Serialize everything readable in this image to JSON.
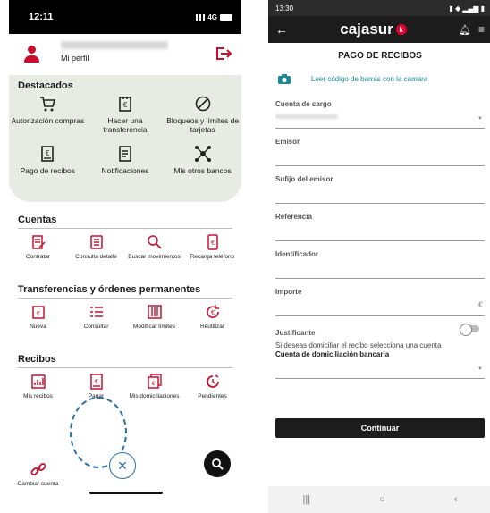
{
  "left": {
    "status": {
      "time": "12:11",
      "network": "4G"
    },
    "profile": {
      "link": "Mi perfil"
    },
    "destacados": {
      "title": "Destacados",
      "items": [
        {
          "label": "Autorización compras",
          "icon": "cart-icon"
        },
        {
          "label": "Hacer una transferencia",
          "icon": "transfer-euro-icon"
        },
        {
          "label": "Bloqueos y límites de tarjetas",
          "icon": "block-icon"
        },
        {
          "label": "Pago de recibos",
          "icon": "receipt-euro-icon"
        },
        {
          "label": "Notificaciones",
          "icon": "notification-doc-icon"
        },
        {
          "label": "Mis otros bancos",
          "icon": "network-icon"
        }
      ]
    },
    "cuentas": {
      "title": "Cuentas",
      "items": [
        {
          "label": "Contratar",
          "icon": "contract-icon"
        },
        {
          "label": "Consulta detalle",
          "icon": "list-doc-icon"
        },
        {
          "label": "Buscar movimientos",
          "icon": "search-icon"
        },
        {
          "label": "Recarga teléfono",
          "icon": "phone-euro-icon"
        }
      ]
    },
    "transferencias": {
      "title": "Transferencias y órdenes permanentes",
      "items": [
        {
          "label": "Nueva",
          "icon": "new-transfer-icon"
        },
        {
          "label": "Consultar",
          "icon": "list-icon"
        },
        {
          "label": "Modificar límites",
          "icon": "sliders-icon"
        },
        {
          "label": "Reutilizar",
          "icon": "reuse-euro-icon"
        }
      ]
    },
    "recibos": {
      "title": "Recibos",
      "items": [
        {
          "label": "Mis recibos",
          "icon": "receipts-chart-icon"
        },
        {
          "label": "Pagar",
          "icon": "pay-receipt-icon"
        },
        {
          "label": "Mis domiciliaciones",
          "icon": "direct-debit-icon"
        },
        {
          "label": "Pendientes",
          "icon": "pending-clock-icon"
        }
      ],
      "extra": {
        "label": "Cambiar cuenta",
        "icon": "link-icon"
      }
    },
    "accent": "#c8102e"
  },
  "right": {
    "status": {
      "time": "13:30"
    },
    "brand": {
      "name": "cajasur",
      "badge": "k"
    },
    "title": "PAGO DE RECIBOS",
    "barcode_link": "Leer código de barras con la camara",
    "fields": [
      {
        "label": "Cuenta de cargo"
      },
      {
        "label": "Emisor"
      },
      {
        "label": "Sufijo del emisor"
      },
      {
        "label": "Referencia"
      },
      {
        "label": "Identificador"
      },
      {
        "label": "Importe",
        "suffix": "€"
      }
    ],
    "justificante": "Justificante",
    "note_text": "Si deseas domiciliar el recibo selecciona una cuenta",
    "note_bold": "Cuenta de domiciliación bancaria",
    "continue_label": "Continuar",
    "accent": "#1a8a9a"
  }
}
